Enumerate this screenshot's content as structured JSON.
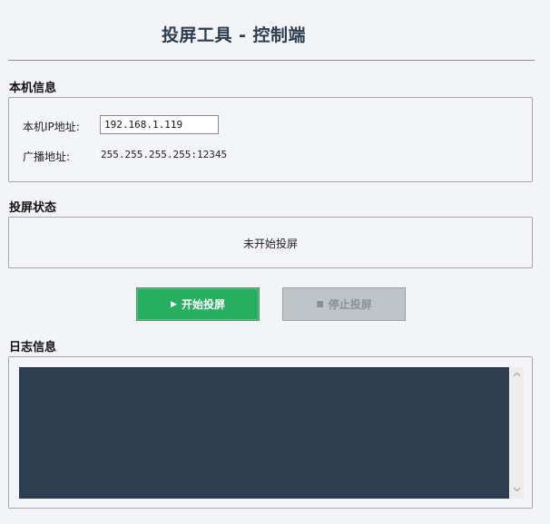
{
  "header": {
    "title": "投屏工具 - 控制端"
  },
  "local_info": {
    "section_label": "本机信息",
    "ip_label": "本机IP地址:",
    "ip_value": "192.168.1.119",
    "broadcast_label": "广播地址:",
    "broadcast_value": "255.255.255.255:12345"
  },
  "status": {
    "section_label": "投屏状态",
    "text": "未开始投屏"
  },
  "controls": {
    "start_glyph": "▶",
    "start_label": "开始投屏",
    "stop_glyph": "■",
    "stop_label": "停止投屏"
  },
  "log": {
    "section_label": "日志信息",
    "content": ""
  },
  "icons": {
    "play": "play-icon",
    "stop": "stop-icon",
    "scroll_up": "chevron-up-icon",
    "scroll_down": "chevron-down-icon"
  },
  "colors": {
    "start_button": "#27ae60",
    "stop_button_disabled": "#bfc4c8",
    "log_background": "#2c3e50",
    "title": "#2c3e50"
  }
}
